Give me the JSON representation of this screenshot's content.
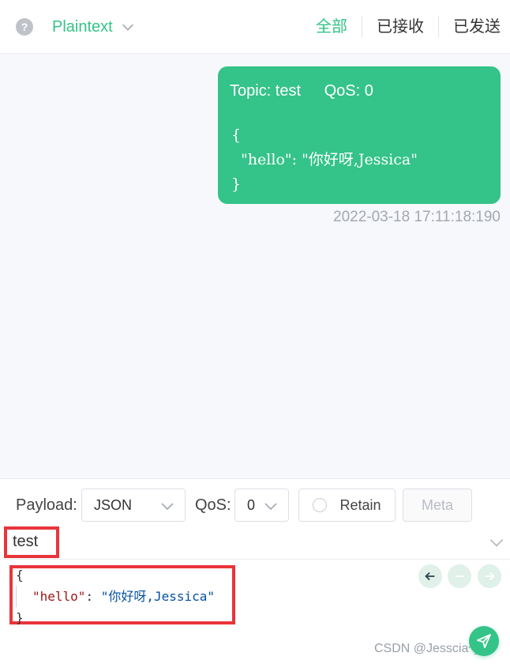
{
  "header": {
    "help_icon": "?",
    "format": "Plaintext",
    "tabs": [
      {
        "label": "全部",
        "active": true
      },
      {
        "label": "已接收",
        "active": false
      },
      {
        "label": "已发送",
        "active": false
      }
    ]
  },
  "message": {
    "topic_label": "Topic: test",
    "qos_label": "QoS: 0",
    "payload": "{\n  \"hello\": \"你好呀,Jessica\"\n}",
    "time": "2022-03-18 17:11:18:190"
  },
  "publish": {
    "payload_label": "Payload:",
    "payload_format": "JSON",
    "qos_label": "QoS:",
    "qos_value": "0",
    "retain_label": "Retain",
    "meta_label": "Meta",
    "topic": "test",
    "code": {
      "open": "{",
      "key": "\"hello\"",
      "sep": ": ",
      "value": "\"你好呀,Jessica\"",
      "close": "}"
    }
  },
  "watermark": "CSDN @Jesscia^_^",
  "colors": {
    "accent": "#34c388",
    "highlight": "#e8353a"
  }
}
